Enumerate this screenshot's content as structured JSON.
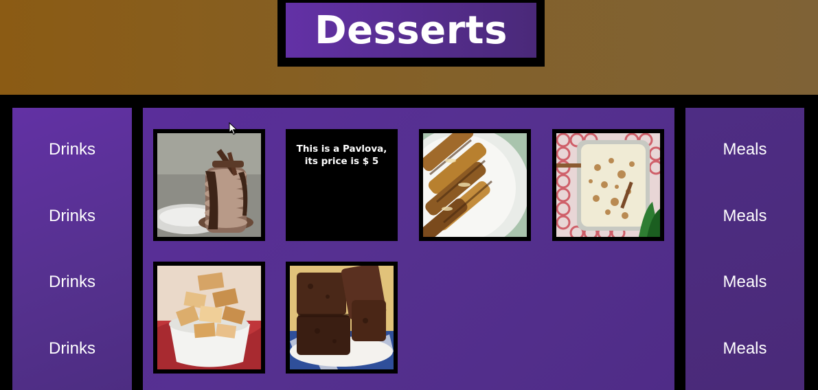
{
  "header": {
    "title": "Desserts"
  },
  "left_nav": {
    "items": [
      "Drinks",
      "Drinks",
      "Drinks",
      "Drinks"
    ]
  },
  "right_nav": {
    "items": [
      "Meals",
      "Meals",
      "Meals",
      "Meals"
    ]
  },
  "grid": {
    "tiles": [
      {
        "image": "chocolate-pancake-stack"
      },
      {
        "caption": "This is a Pavlova, its price is $ 5"
      },
      {
        "image": "crepe-rolls-plate"
      },
      {
        "image": "rice-pudding-dish"
      },
      {
        "image": "fudge-bowl"
      },
      {
        "image": "brownies-stack"
      }
    ]
  },
  "colors": {
    "header": "#8b5b14",
    "panel": "#5a2e9a",
    "frame": "#000000",
    "text": "#ffffff"
  }
}
